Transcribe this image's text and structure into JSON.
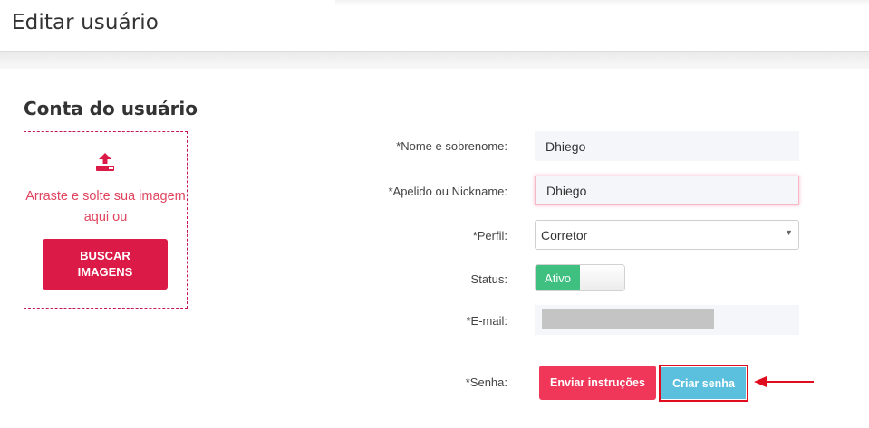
{
  "page": {
    "title": "Editar usuário"
  },
  "section": {
    "title": "Conta do usuário"
  },
  "upload": {
    "text": "Arraste e solte sua imagem aqui ou",
    "button_label": "BUSCAR\nIMAGENS",
    "icon": "upload-icon",
    "accent_color": "#dc1a47"
  },
  "form": {
    "name": {
      "label": "*Nome e sobrenome:",
      "value": "Dhiego"
    },
    "nickname": {
      "label": "*Apelido ou Nickname:",
      "value": "Dhiego"
    },
    "profile": {
      "label": "*Perfil:",
      "value": "Corretor"
    },
    "status": {
      "label": "Status:",
      "value": "Ativo",
      "on_color": "#3fbf80"
    },
    "email": {
      "label": "*E-mail:"
    },
    "password": {
      "label": "*Senha:",
      "send_button": "Enviar instruções",
      "create_button": "Criar senha"
    }
  },
  "colors": {
    "send_button": "#f0375a",
    "create_button": "#5bc0de",
    "highlight": "#e00d1f"
  }
}
